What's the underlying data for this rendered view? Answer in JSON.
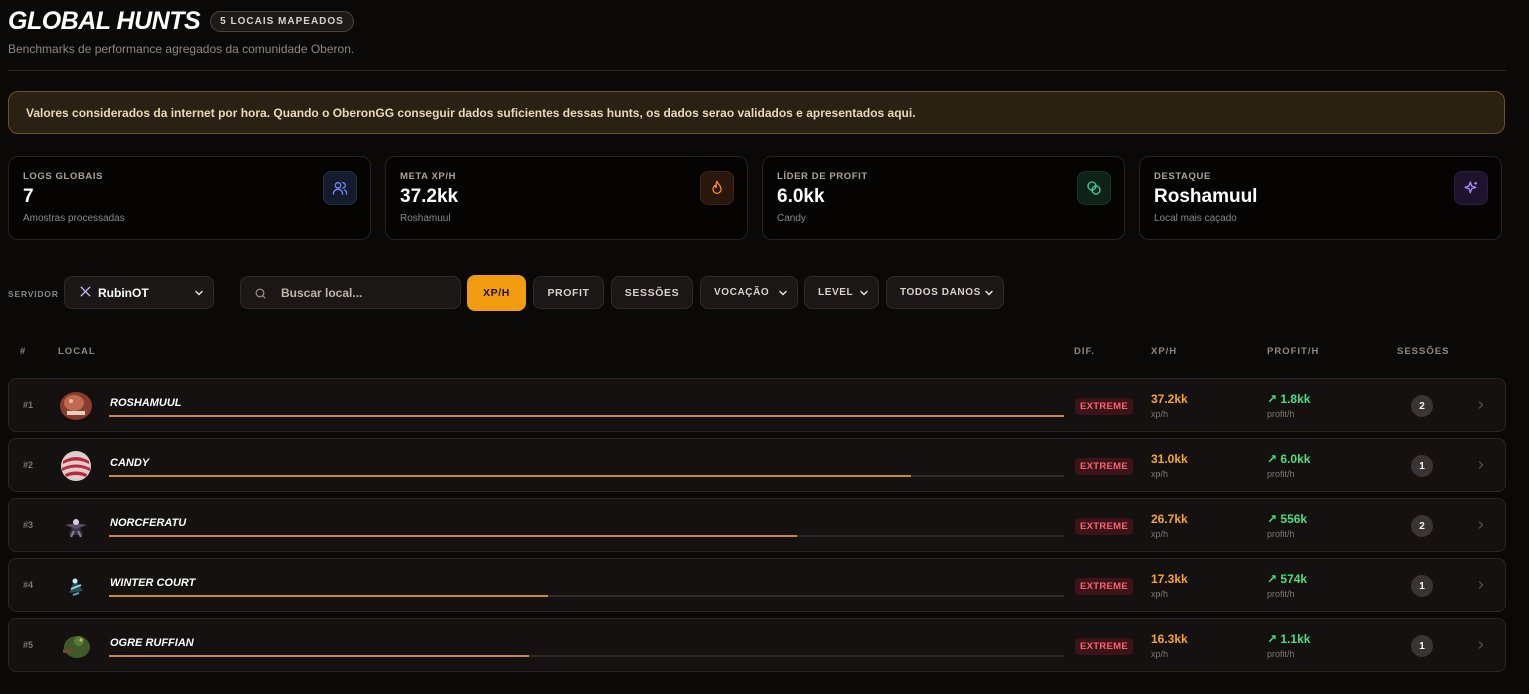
{
  "header": {
    "title": "GLOBAL HUNTS",
    "badge": "5 LOCAIS MAPEADOS",
    "subtitle": "Benchmarks de performance agregados da comunidade Oberon."
  },
  "notice": "Valores considerados da internet por hora. Quando o OberonGG conseguir dados suficientes dessas hunts, os dados serao validados e apresentados aqui.",
  "stats": [
    {
      "label": "LOGS GLOBAIS",
      "value": "7",
      "sub": "Amostras processadas",
      "icon": "users-icon",
      "color": "#6d8cff"
    },
    {
      "label": "META XP/H",
      "value": "37.2kk",
      "sub": "Roshamuul",
      "icon": "flame-icon",
      "color": "#f08a24"
    },
    {
      "label": "LÍDER DE PROFIT",
      "value": "6.0kk",
      "sub": "Candy",
      "icon": "coins-icon",
      "color": "#34d399"
    },
    {
      "label": "DESTAQUE",
      "value": "Roshamuul",
      "sub": "Local mais caçado",
      "icon": "sparkles-icon",
      "color": "#a78bfa"
    }
  ],
  "filters": {
    "server_label": "SERVIDOR",
    "server_value": "RubinOT",
    "search_placeholder": "Buscar local...",
    "sort_buttons": [
      "XP/H",
      "PROFIT",
      "SESSÕES"
    ],
    "dropdowns": [
      "VOCAÇÃO",
      "LEVEL",
      "TODOS DANOS"
    ]
  },
  "table": {
    "headers": [
      "#",
      "LOCAL",
      "DIF.",
      "XP/H",
      "PROFIT/H",
      "SESSÕES"
    ],
    "rows": [
      {
        "rank": "#1",
        "name": "ROSHAMUUL",
        "fill": 1.0,
        "difficulty": "EXTREME",
        "xp": "37.2kk",
        "xp_unit": "xp/h",
        "profit": "1.8kk",
        "profit_unit": "profit/h",
        "sessions": "2"
      },
      {
        "rank": "#2",
        "name": "CANDY",
        "fill": 0.84,
        "difficulty": "EXTREME",
        "xp": "31.0kk",
        "xp_unit": "xp/h",
        "profit": "6.0kk",
        "profit_unit": "profit/h",
        "sessions": "1"
      },
      {
        "rank": "#3",
        "name": "NORCFERATU",
        "fill": 0.72,
        "difficulty": "EXTREME",
        "xp": "26.7kk",
        "xp_unit": "xp/h",
        "profit": "556k",
        "profit_unit": "profit/h",
        "sessions": "2"
      },
      {
        "rank": "#4",
        "name": "WINTER COURT",
        "fill": 0.46,
        "difficulty": "EXTREME",
        "xp": "17.3kk",
        "xp_unit": "xp/h",
        "profit": "574k",
        "profit_unit": "profit/h",
        "sessions": "1"
      },
      {
        "rank": "#5",
        "name": "OGRE RUFFIAN",
        "fill": 0.44,
        "difficulty": "EXTREME",
        "xp": "16.3kk",
        "xp_unit": "xp/h",
        "profit": "1.1kk",
        "profit_unit": "profit/h",
        "sessions": "1"
      }
    ]
  },
  "colors": {
    "accent": "#f29c11",
    "xp": "#f5a623",
    "profit": "#4ade80",
    "difficulty": "#ff5f6d"
  }
}
